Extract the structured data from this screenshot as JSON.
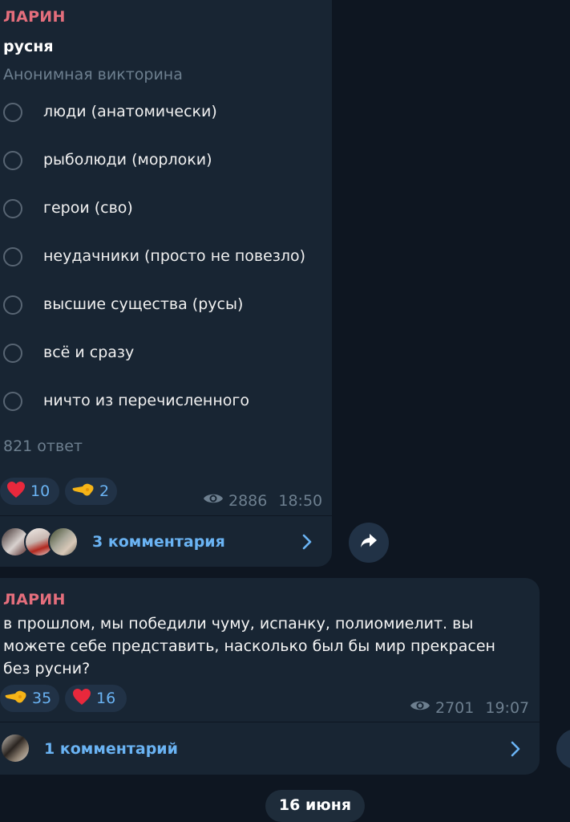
{
  "poll_post": {
    "author": "ЛАРИН",
    "question": "русня",
    "poll_type": "Анонимная викторина",
    "options": [
      "люди (анатомически)",
      "рыболюди (морлоки)",
      "герои (сво)",
      "неудачники (просто не повезло)",
      "высшие существа (русы)",
      "всё и сразу",
      "ничто из перечисленного"
    ],
    "votes": "821 ответ",
    "reactions": [
      {
        "icon": "heart-icon",
        "count": "10"
      },
      {
        "icon": "pointing-hand-icon",
        "count": "2"
      }
    ],
    "views": "2886",
    "time": "18:50",
    "comments_label": "3 комментария"
  },
  "text_post": {
    "author": "ЛАРИН",
    "text": "в прошлом, мы победили чуму, испанку, полиомиелит. вы можете себе представить, насколько был бы мир прекрасен без русни?",
    "reactions": [
      {
        "icon": "pointing-hand-icon",
        "count": "35"
      },
      {
        "icon": "heart-icon",
        "count": "16"
      }
    ],
    "views": "2701",
    "time": "19:07",
    "comments_label": "1 комментарий"
  },
  "date_separator": "16 июня",
  "colors": {
    "background": "#0e1621",
    "bubble": "#182533",
    "author": "#e46e7c",
    "accent": "#6ab3f3",
    "muted": "#6d7f8f"
  }
}
